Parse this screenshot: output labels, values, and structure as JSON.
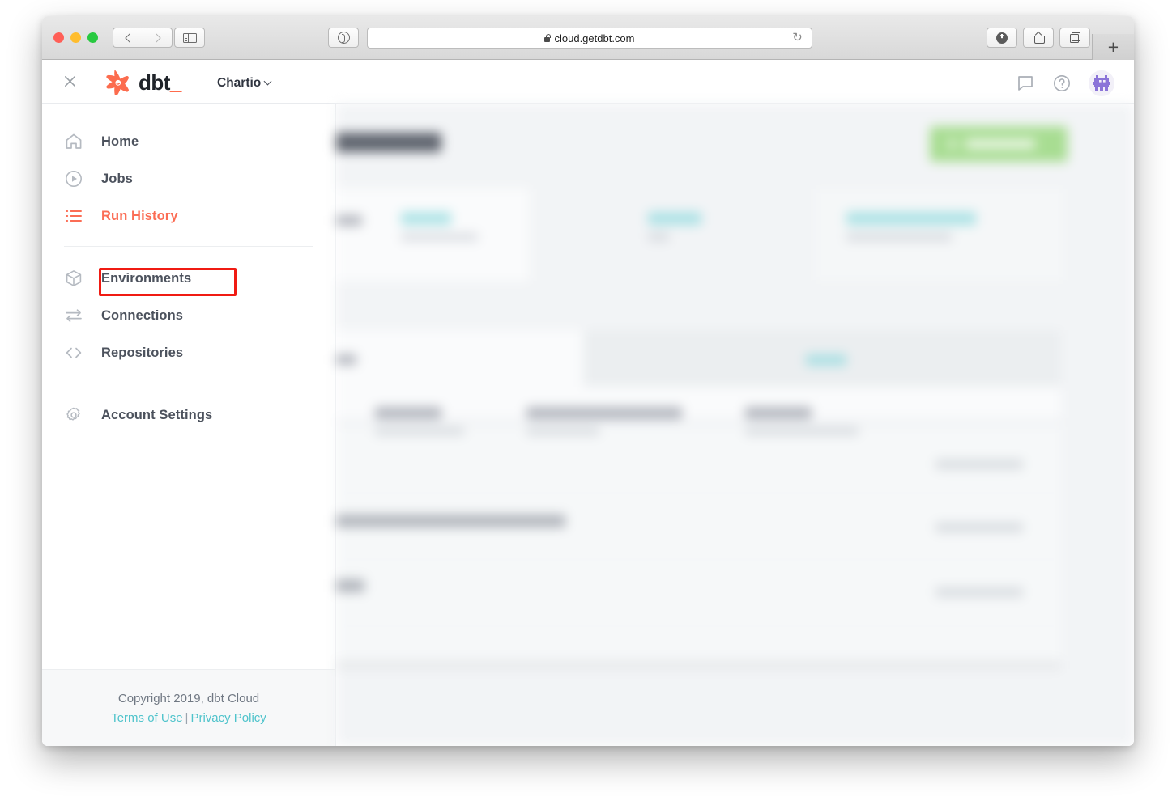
{
  "browser": {
    "url": "cloud.getdbt.com",
    "lock_icon": "lock-icon",
    "back_icon": "chevron-left-icon",
    "forward_icon": "chevron-right-icon",
    "sidebar_icon": "sidebar-toggle-icon",
    "reader_icon": "reader-view-icon",
    "reload_icon": "reload-icon",
    "reload_glyph": "↻",
    "download_icon": "download-icon",
    "share_icon": "share-icon",
    "tabs_icon": "tab-overview-icon",
    "newtab_label": "+"
  },
  "app_header": {
    "close_icon": "close-icon",
    "logo_icon": "dbt-logo-icon",
    "wordmark": "dbt",
    "wordmark_suffix": "_",
    "org_name": "Chartio",
    "org_caret_icon": "chevron-down-icon",
    "chat_icon": "chat-bubble-icon",
    "help_icon": "help-circle-icon",
    "help_glyph": "?",
    "avatar_icon": "user-avatar"
  },
  "sidebar": {
    "items": [
      {
        "label": "Home",
        "icon": "home-icon",
        "active": false
      },
      {
        "label": "Jobs",
        "icon": "play-circle-icon",
        "active": false
      },
      {
        "label": "Run History",
        "icon": "list-icon",
        "active": true
      },
      {
        "label": "Environments",
        "icon": "cube-icon",
        "active": false
      },
      {
        "label": "Connections",
        "icon": "transfer-icon",
        "active": false
      },
      {
        "label": "Repositories",
        "icon": "code-brackets-icon",
        "active": false
      },
      {
        "label": "Account Settings",
        "icon": "gear-icon",
        "active": false
      }
    ],
    "highlight": {
      "target": "Jobs",
      "color": "#f01b13"
    },
    "footer": {
      "copyright": "Copyright 2019, dbt Cloud",
      "terms_label": "Terms of Use",
      "separator": "|",
      "privacy_label": "Privacy Policy"
    }
  },
  "main": {
    "blurred": true,
    "note": "main content area is blurred out in the screenshot"
  },
  "colors": {
    "accent_orange": "#fb6d55",
    "link_teal": "#4ec3cb",
    "highlight_red": "#f01b13",
    "nav_text": "#4c525d",
    "content_bg": "#f2f4f6"
  }
}
